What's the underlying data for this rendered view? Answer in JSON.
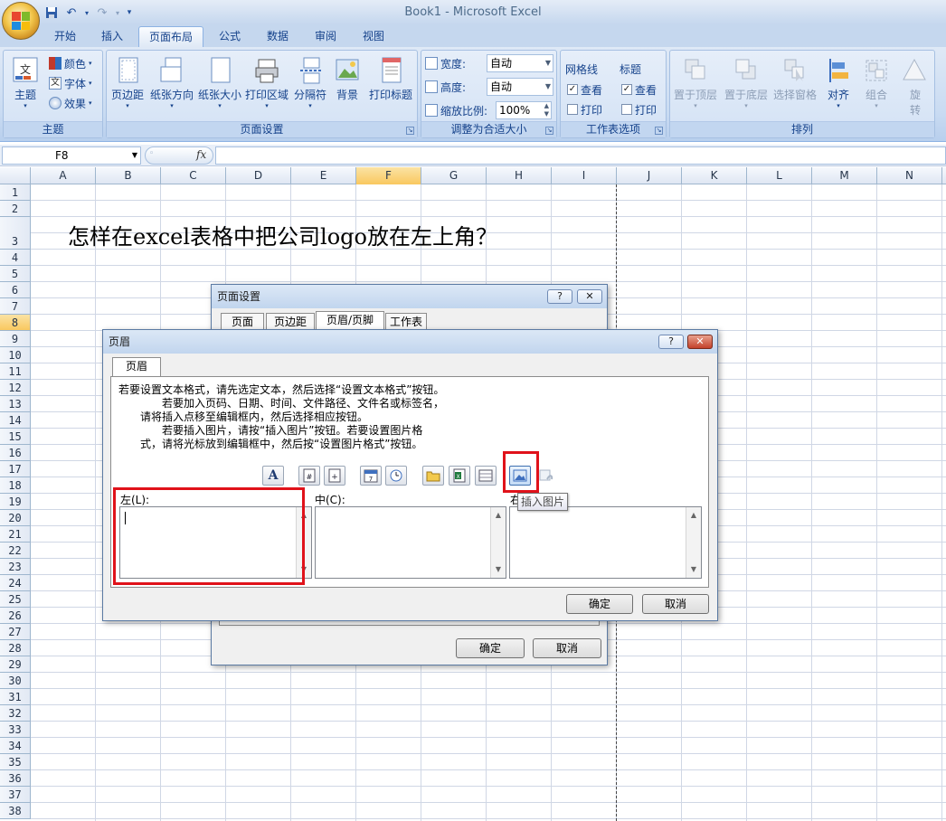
{
  "window": {
    "title": "Book1 - Microsoft Excel"
  },
  "tabs": [
    {
      "label": "开始",
      "active": false
    },
    {
      "label": "插入",
      "active": false
    },
    {
      "label": "页面布局",
      "active": true
    },
    {
      "label": "公式",
      "active": false
    },
    {
      "label": "数据",
      "active": false
    },
    {
      "label": "审阅",
      "active": false
    },
    {
      "label": "视图",
      "active": false
    }
  ],
  "ribbon": {
    "theme_group": {
      "label": "主题",
      "big": "主题",
      "colors": "颜色",
      "fonts": "字体",
      "effects": "效果"
    },
    "page_setup_group": {
      "label": "页面设置",
      "buttons": [
        "页边距",
        "纸张方向",
        "纸张大小",
        "打印区域",
        "分隔符",
        "背景",
        "打印标题"
      ]
    },
    "scale_group": {
      "label": "调整为合适大小",
      "width_label": "宽度:",
      "width_value": "自动",
      "height_label": "高度:",
      "height_value": "自动",
      "scale_label": "缩放比例:",
      "scale_value": "100%"
    },
    "sheet_options_group": {
      "label": "工作表选项",
      "gridlines": "网格线",
      "headings": "标题",
      "view": "查看",
      "print": "打印",
      "gridlines_view": true,
      "gridlines_print": false,
      "headings_view": true,
      "headings_print": false
    },
    "arrange_group": {
      "label": "排列",
      "buttons": [
        "置于顶层",
        "置于底层",
        "选择窗格",
        "对齐",
        "组合",
        "旋转"
      ]
    }
  },
  "formula_bar": {
    "name_box": "F8",
    "fx": "fx",
    "content": ""
  },
  "sheet": {
    "columns": [
      "A",
      "B",
      "C",
      "D",
      "E",
      "F",
      "G",
      "H",
      "I",
      "J",
      "K",
      "L",
      "M",
      "N"
    ],
    "selected_column": "F",
    "rows": [
      "1",
      "2",
      "3",
      "4",
      "5",
      "6",
      "7",
      "8",
      "9",
      "10",
      "11",
      "12",
      "13",
      "14",
      "15",
      "16",
      "17",
      "18",
      "19",
      "20",
      "21",
      "22",
      "23",
      "24",
      "25",
      "26",
      "27",
      "28",
      "29",
      "30",
      "31",
      "32",
      "33",
      "34",
      "35",
      "36",
      "37",
      "38"
    ],
    "selected_row": "8",
    "cell_A3": "怎样在excel表格中把公司logo放在左上角？"
  },
  "page_setup_dialog": {
    "title": "页面设置",
    "help": "?",
    "close": "✕",
    "tabs": [
      "页面",
      "页边距",
      "页眉/页脚",
      "工作表"
    ],
    "active_tab": "页眉/页脚",
    "ok": "确定",
    "cancel": "取消"
  },
  "header_dialog": {
    "title": "页眉",
    "help": "?",
    "close": "✕",
    "tab": "页眉",
    "instructions": [
      "若要设置文本格式，请先选定文本，然后选择“设置文本格式”按钮。",
      "若要加入页码、日期、时间、文件路径、文件名或标签名，",
      "请将插入点移至编辑框内，然后选择相应按钮。",
      "若要插入图片，请按“插入图片”按钮。若要设置图片格",
      "式，请将光标放到编辑框中，然后按“设置图片格式”按钮。"
    ],
    "toolbar_icons": [
      "format-text-icon",
      "page-number-icon",
      "page-count-icon",
      "date-icon",
      "time-icon",
      "file-path-icon",
      "file-name-icon",
      "sheet-name-icon",
      "insert-picture-icon",
      "format-picture-icon"
    ],
    "left_label": "左(L):",
    "center_label": "中(C):",
    "right_label": "右(R):",
    "tooltip": "插入图片",
    "ok": "确定",
    "cancel": "取消"
  },
  "colors": {
    "highlight": "#e0121a",
    "accent": "#15428b",
    "selected_header": "#f9c85f"
  }
}
